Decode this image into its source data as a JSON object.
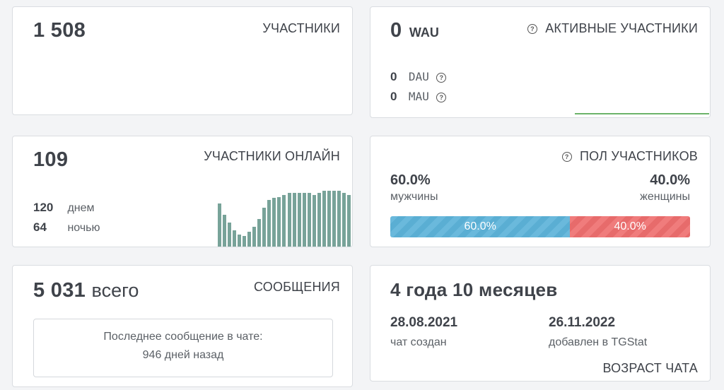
{
  "members": {
    "count": "1 508",
    "title": "УЧАСТНИКИ"
  },
  "active": {
    "count": "0",
    "unit": "WAU",
    "title": "АКТИВНЫЕ УЧАСТНИКИ",
    "dau_value": "0",
    "dau_label": "DAU",
    "mau_value": "0",
    "mau_label": "MAU",
    "sparkline_color": "#6cb36a"
  },
  "online": {
    "count": "109",
    "title": "УЧАСТНИКИ ОНЛАЙН",
    "day_value": "120",
    "day_label": "днем",
    "night_value": "64",
    "night_label": "ночью",
    "bar_color": "#78a399",
    "hourly_bars": [
      0.65,
      0.48,
      0.36,
      0.24,
      0.18,
      0.16,
      0.22,
      0.3,
      0.42,
      0.58,
      0.7,
      0.73,
      0.75,
      0.78,
      0.81,
      0.81,
      0.81,
      0.81,
      0.81,
      0.78,
      0.81,
      0.84,
      0.84,
      0.84,
      0.84,
      0.81,
      0.78
    ]
  },
  "gender": {
    "title": "ПОЛ УЧАСТНИКОВ",
    "male_percent": "60.0%",
    "male_label": "мужчины",
    "female_percent": "40.0%",
    "female_label": "женщины",
    "male_share": 0.6,
    "male_bar_label": "60.0%",
    "female_bar_label": "40.0%",
    "male_color": "#6ab9dc",
    "female_color": "#f07c7c"
  },
  "messages": {
    "count": "5 031",
    "suffix": "всего",
    "title": "СООБЩЕНИЯ",
    "last_line1": "Последнее сообщение в чате:",
    "last_line2": "946 дней назад"
  },
  "age": {
    "value": "4 года 10 месяцев",
    "created_date": "28.08.2021",
    "created_label": "чат создан",
    "added_date": "26.11.2022",
    "added_label": "добавлен в TGStat",
    "title": "ВОЗРАСТ ЧАТА"
  }
}
